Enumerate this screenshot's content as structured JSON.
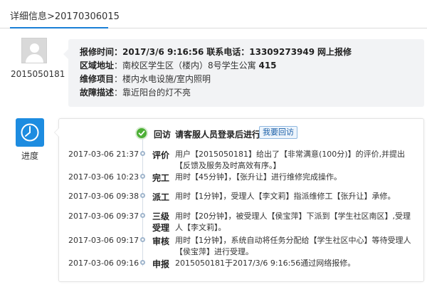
{
  "header": {
    "title": "详细信息>20170306015"
  },
  "user": {
    "id": "2015050181"
  },
  "info": {
    "repair_time_label": "报修时间：",
    "repair_time": "2017/3/6 9:16:56",
    "phone_label": "联系电话：",
    "phone": "13309273949",
    "channel": "网上报修",
    "area_label": "区域地址",
    "area_value": "：南校区学生区（楼内）8号学生公寓",
    "room": "415",
    "item_label": "维修项目",
    "item_value": "：楼内水电设施/室内照明",
    "fault_label": "故障描述",
    "fault_value": "：靠近阳台的灯不亮"
  },
  "progress": {
    "label": "进度",
    "revisit_label": "回访",
    "revisit_message": "请客服人员登录后进行回访",
    "revisit_button": "我要回访"
  },
  "timeline": [
    {
      "time": "2017-03-06 21:37",
      "type": "评价",
      "desc": "用户【2015050181】给出了【非常满意(100分)】的评价,并提出【反馈及服务及时高效有序。】"
    },
    {
      "time": "2017-03-06 10:23",
      "type": "完工",
      "desc": "用时【45分钟】，【张升让】进行维修完成操作。"
    },
    {
      "time": "2017-03-06 09:38",
      "type": "派工",
      "desc": "用时【1分钟】，受理人【李文莉】指派维修工【张升让】承修。"
    },
    {
      "time": "2017-03-06 09:37",
      "type": "三级受理",
      "desc": "用时【20分钟】，被受理人【侯宝萍】下派到【学生社区南区】,受理人【李文莉】。"
    },
    {
      "time": "2017-03-06 09:17",
      "type": "审核",
      "desc": "用时【1分钟】，系统自动将任务分配给【学生社区中心】等待受理人【侯宝萍】进行受理。"
    },
    {
      "time": "2017-03-06 09:16",
      "type": "申报",
      "desc": "2015050181于2017/3/6 9:16:56通过网络报修。"
    }
  ],
  "colors": {
    "accent": "#1a7fd6",
    "icon_bg": "#1d8ce0",
    "check_green": "#4caf35",
    "card_bg": "#f2f3f5"
  },
  "icons": {
    "avatar": "user-avatar-icon",
    "progress": "clock-icon",
    "revisit": "check-circle-icon"
  }
}
